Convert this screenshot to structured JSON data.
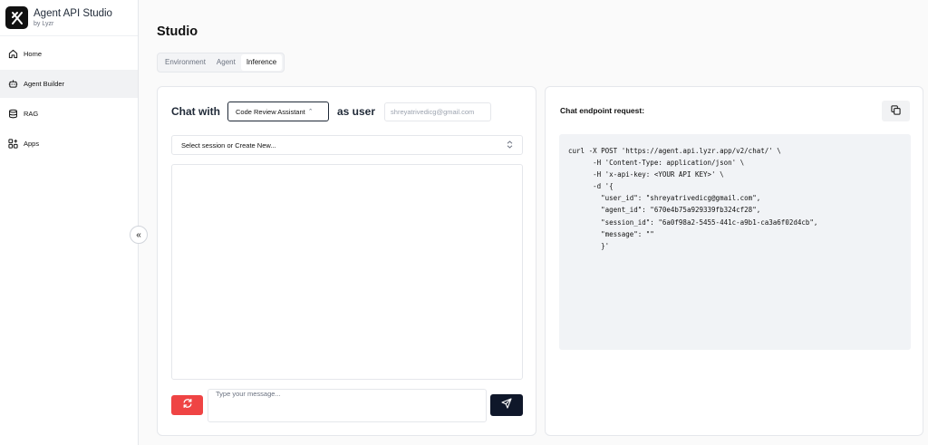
{
  "brand": {
    "title": "Agent API Studio",
    "subtitle": "by Lyzr"
  },
  "sidebar": {
    "items": [
      {
        "label": "Home",
        "icon": "home-icon"
      },
      {
        "label": "Agent Builder",
        "icon": "bot-icon"
      },
      {
        "label": "RAG",
        "icon": "database-icon"
      },
      {
        "label": "Apps",
        "icon": "apps-icon"
      }
    ],
    "collapse_label": "«"
  },
  "main": {
    "title": "Studio",
    "tabs": [
      "Environment",
      "Agent",
      "Inference"
    ],
    "active_tab": "Inference"
  },
  "chat": {
    "chat_with_label": "Chat with",
    "agent_selected": "Code Review Assistant",
    "as_user_label": "as user",
    "user_email": "shreyatrivedicg@gmail.com",
    "session_placeholder": "Select session or Create New...",
    "message_placeholder": "Type your message..."
  },
  "endpoint": {
    "title": "Chat endpoint request:",
    "code_lines": [
      "curl -X POST 'https://agent.api.lyzr.app/v2/chat/' \\",
      "      -H 'Content-Type: application/json' \\",
      "      -H 'x-api-key: <YOUR API KEY>' \\",
      "      -d '{",
      "        \"user_id\": \"shreyatrivedicg@gmail.com\",",
      "        \"agent_id\": \"670e4b75a929339fb324cf28\",",
      "        \"session_id\": \"6a0f98a2-5455-441c-a9b1-ca3a6f02d4cb\",",
      "        \"message\": \"\"",
      "        }'"
    ]
  },
  "colors": {
    "accent_dark": "#0f172a",
    "reset_red": "#ef4444",
    "code_bg": "#f1f3f6"
  }
}
